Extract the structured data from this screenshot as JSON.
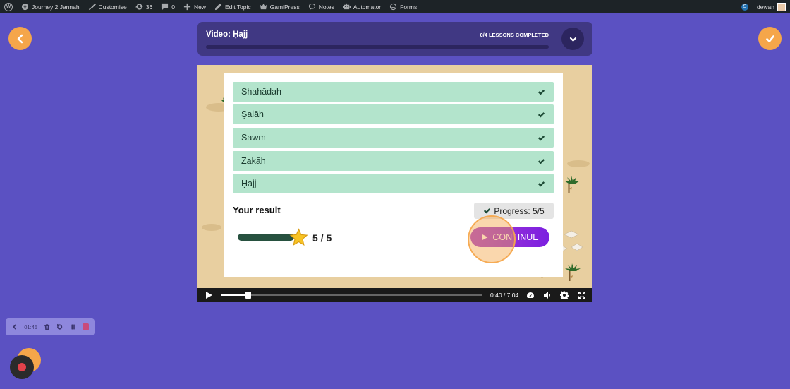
{
  "admin_bar": {
    "site_name": "Journey 2 Jannah",
    "customise": "Customise",
    "updates_count": "36",
    "comments_count": "0",
    "new": "New",
    "edit_topic": "Edit Topic",
    "gamipress": "GamiPress",
    "notes": "Notes",
    "automator": "Automator",
    "forms": "Forms",
    "user_name": "dewan"
  },
  "header": {
    "title": "Video: Ḥajj",
    "lessons_completed": "0/4 LESSONS COMPLETED",
    "progress_percent": 0
  },
  "quiz": {
    "answers": [
      {
        "label": "Shahādah"
      },
      {
        "label": "Ṣalāh"
      },
      {
        "label": "Sawm"
      },
      {
        "label": "Zakāh"
      },
      {
        "label": "Ḥajj"
      }
    ],
    "result_heading": "Your result",
    "progress_label": "Progress: 5/5",
    "score": "5 / 5",
    "score_fraction": 1.0,
    "continue_label": "CONTINUE"
  },
  "video_controls": {
    "time": "0:40 / 7:04",
    "played_fraction": 0.095
  },
  "recorder": {
    "elapsed": "01:45"
  },
  "colors": {
    "background": "#5b51c2",
    "accent_orange": "#f5a64a",
    "answer_green": "#b3e4cc",
    "continue_purple": "#8f2fda"
  }
}
